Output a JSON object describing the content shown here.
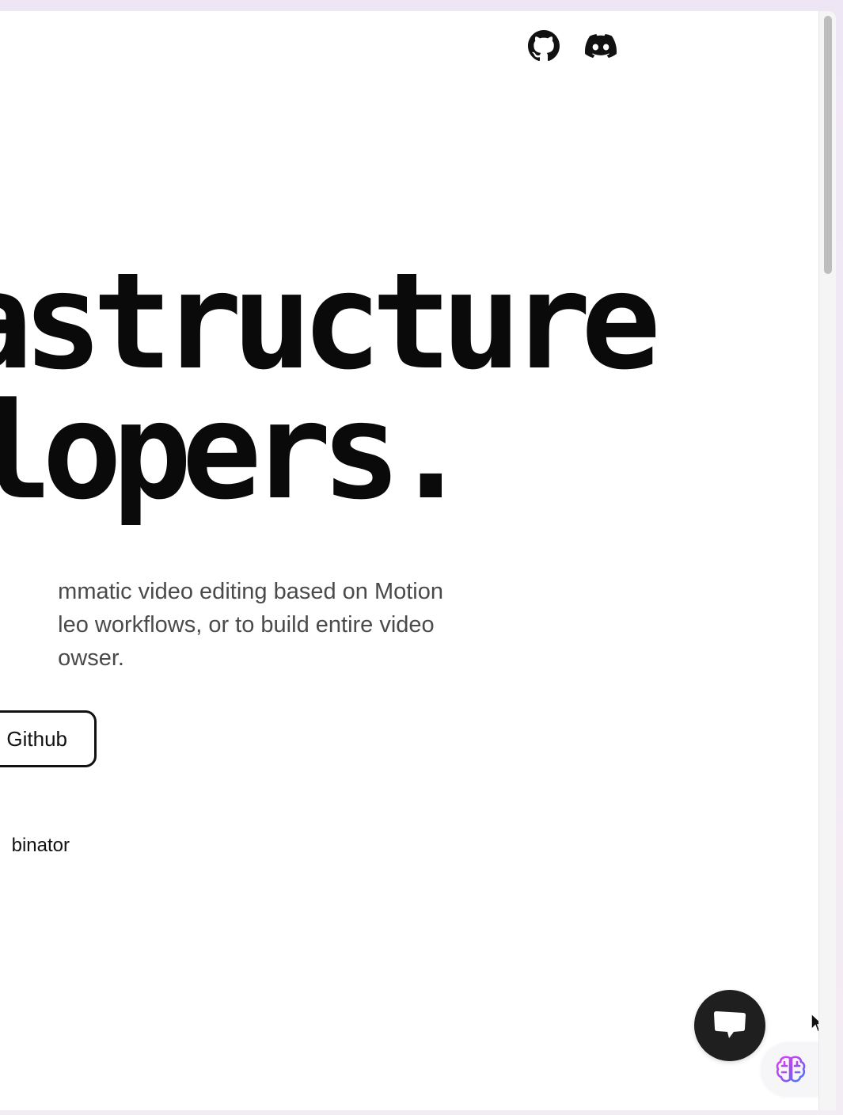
{
  "nav": {
    "github_icon": "github-icon",
    "discord_icon": "discord-icon"
  },
  "hero": {
    "headline_line1": "astructure",
    "headline_line2": "lopers.",
    "subtitle_lines": [
      "mmatic video editing based on Motion",
      "leo workflows, or to build entire video",
      "owser."
    ],
    "github_button_label": "Github",
    "backed_by_text": "binator"
  },
  "widgets": {
    "chat_icon": "chat-bubble-icon",
    "brain_icon": "brain-icon"
  },
  "colors": {
    "text": "#0a0a0a",
    "subtitle": "#4a4a4a",
    "chat_bg": "#1f1f1f"
  }
}
